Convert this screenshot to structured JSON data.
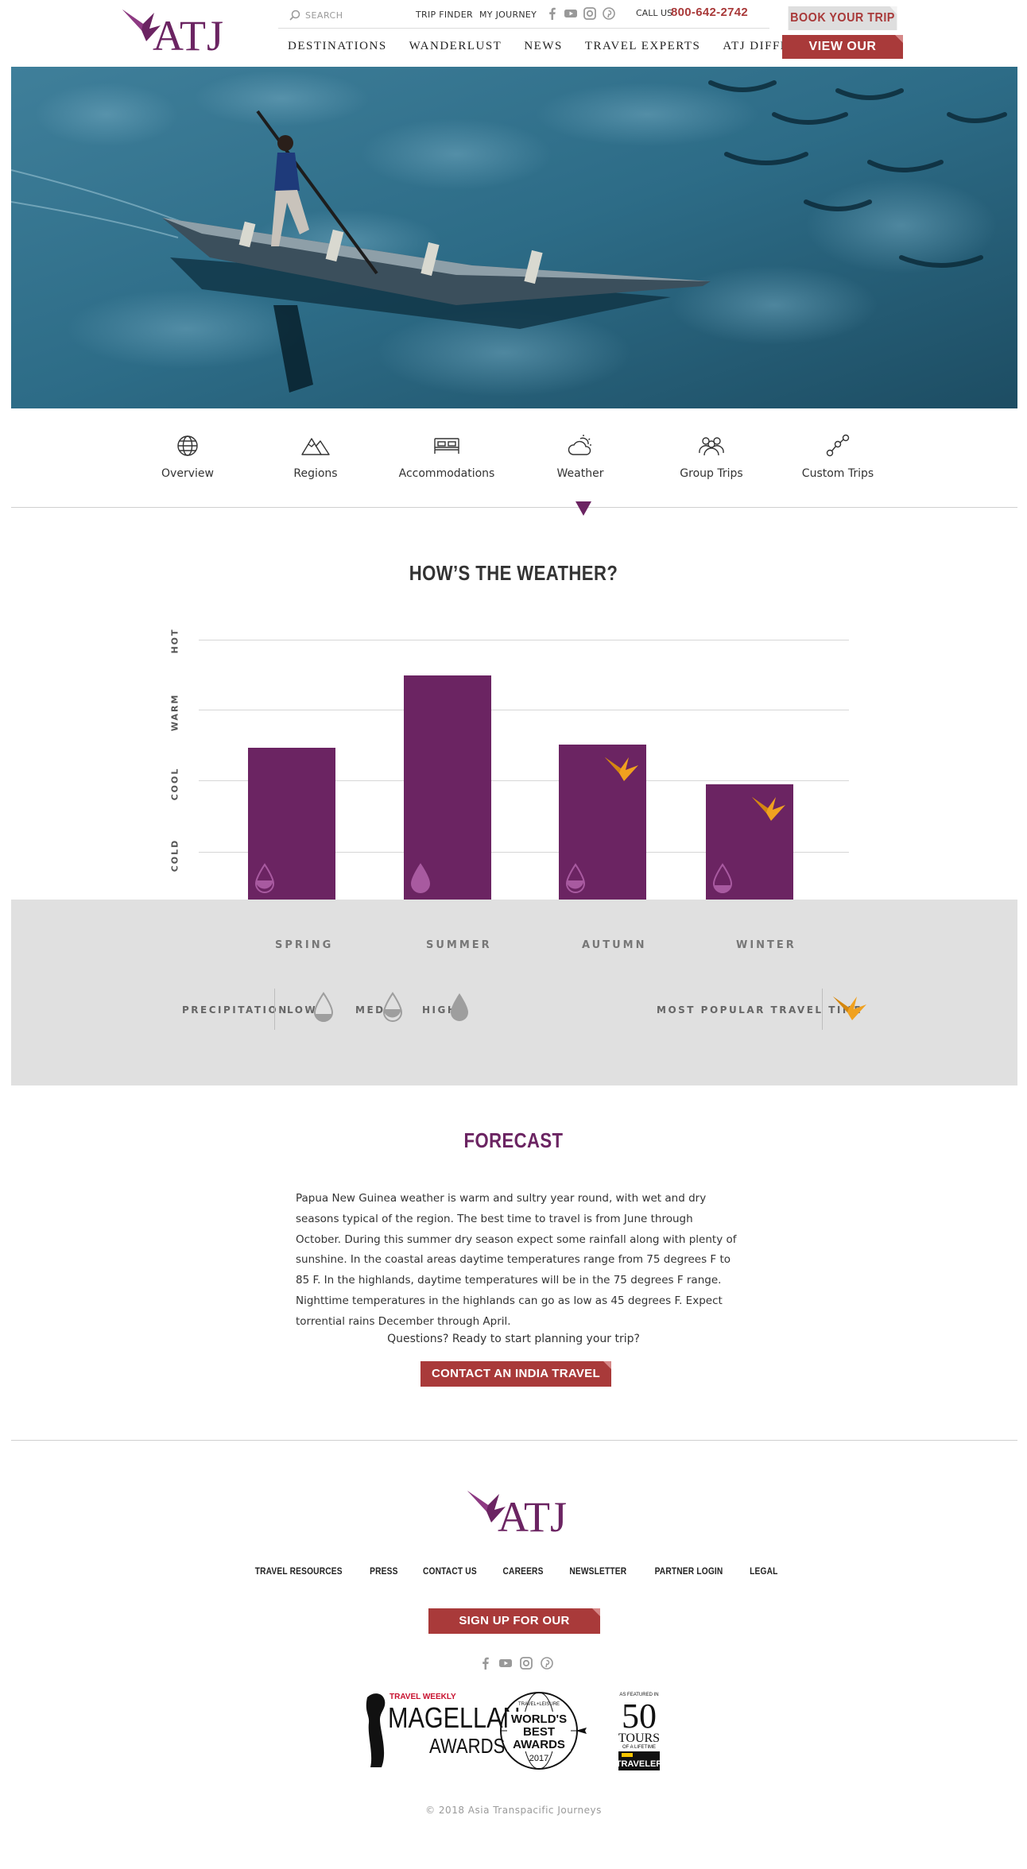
{
  "brand": {
    "name": "ATJ",
    "purple": "#6b2462",
    "red": "#a93a3a",
    "orange": "#f0a11f"
  },
  "header": {
    "search_placeholder": "SEARCH",
    "trip_finder": "TRIP FINDER",
    "my_journey": "MY JOURNEY",
    "social": [
      "facebook-icon",
      "youtube-icon",
      "instagram-icon",
      "pinterest-icon"
    ],
    "call_us": "CALL US",
    "phone": "800-642-2742",
    "book_label": "BOOK YOUR TRIP",
    "catalog_label": "VIEW OUR CATALOG",
    "nav": [
      "DESTINATIONS",
      "WANDERLUST",
      "NEWS",
      "TRAVEL EXPERTS",
      "ATJ DIFFERENCE"
    ]
  },
  "tabs": [
    {
      "label": "Overview",
      "icon": "globe-icon"
    },
    {
      "label": "Regions",
      "icon": "mountains-icon"
    },
    {
      "label": "Accommodations",
      "icon": "bed-icon"
    },
    {
      "label": "Weather",
      "icon": "cloud-sun-icon"
    },
    {
      "label": "Group Trips",
      "icon": "group-icon"
    },
    {
      "label": "Custom Trips",
      "icon": "route-icon"
    }
  ],
  "weather": {
    "title": "HOW’S THE WEATHER?",
    "y_labels": [
      "HOT",
      "WARM",
      "COOL",
      "COLD"
    ],
    "seasons": [
      "SPRING",
      "SUMMER",
      "AUTUMN",
      "WINTER"
    ]
  },
  "chart_data": {
    "type": "bar",
    "title": "HOW’S THE WEATHER?",
    "categories": [
      "SPRING",
      "SUMMER",
      "AUTUMN",
      "WINTER"
    ],
    "y_scale": [
      "COLD",
      "COOL",
      "WARM",
      "HOT"
    ],
    "values": [
      2.1,
      3.1,
      2.15,
      1.6
    ],
    "ylim": [
      0,
      3.6
    ],
    "precipitation": [
      "med",
      "high",
      "med",
      "low"
    ],
    "most_popular": [
      false,
      false,
      true,
      true
    ],
    "grid": true
  },
  "legend": {
    "precipitation": "PRECIPITATION",
    "low": "LOW",
    "med": "MED",
    "high": "HIGH",
    "most_popular": "MOST POPULAR TRAVEL TIME"
  },
  "forecast": {
    "title": "FORECAST",
    "body": "Papua New Guinea weather is warm and sultry year round, with wet and dry seasons typical of the region. The best time to travel is from June through October. During this summer dry season expect some rainfall along with plenty of sunshine. In the coastal areas daytime temperatures range from 75 degrees F to 85 F. In the highlands, daytime temperatures will be in the 75 degrees F range. Nighttime temperatures in the highlands can go as low as 45 degrees F. Expect torrential rains December through April.",
    "question": "Questions? Ready to start planning your trip?",
    "contact_label": "CONTACT AN INDIA TRAVEL EXPERT"
  },
  "footer": {
    "nav": [
      "TRAVEL RESOURCES",
      "PRESS",
      "CONTACT US",
      "CAREERS",
      "NEWSLETTER",
      "PARTNER LOGIN",
      "LEGAL"
    ],
    "newsletter_label": "SIGN UP FOR OUR NEWSLETTER",
    "awards": {
      "magellan_top": "TRAVEL WEEKLY",
      "magellan_main": "MAGELLAN",
      "magellan_sub": "AWARDS",
      "wba_top": "TRAVEL+LEISURE",
      "wba_l1": "WORLD'S",
      "wba_l2": "BEST",
      "wba_l3": "AWARDS",
      "wba_year": "2017",
      "t50_top": "AS FEATURED IN",
      "t50_num": "50",
      "t50_l1": "TOURS",
      "t50_l2": "OF A LIFETIME",
      "t50_brand": "TRAVELER"
    },
    "copyright": "© 2018 Asia Transpacific Journeys"
  }
}
